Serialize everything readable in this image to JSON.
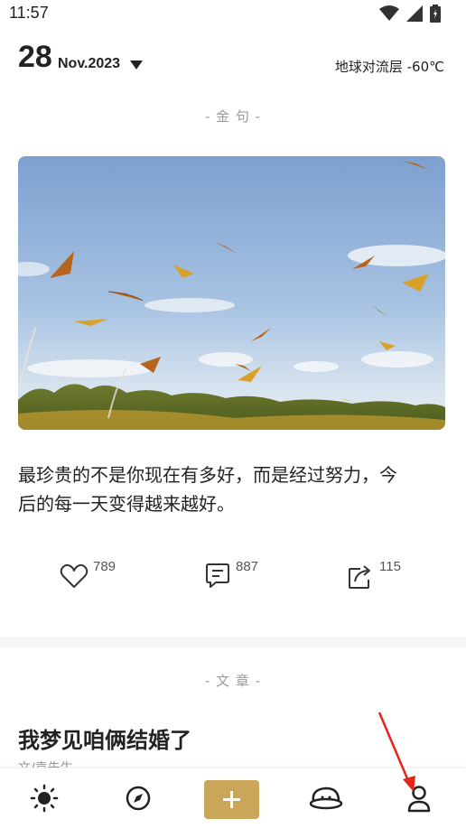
{
  "status_bar": {
    "time": "11:57"
  },
  "header": {
    "day": "28",
    "month_year": "Nov.2023",
    "weather": "地球对流层 -60℃"
  },
  "quote_section": {
    "label": "- 金 句 -",
    "text_line1": "最珍贵的不是你现在有多好，而是经过努力，今",
    "text_line2": "后的每一天变得越来越好。",
    "likes": "789",
    "comments": "887",
    "shares": "115"
  },
  "article_section": {
    "label": "- 文 章 -",
    "title": "我梦见咱俩结婚了",
    "author": "文/袁先生"
  },
  "bottom_nav": {
    "items": [
      "sun-icon",
      "compass-icon",
      "add-icon",
      "planet-icon",
      "profile-icon"
    ],
    "accent_color": "#c9a65a"
  },
  "annotation": {
    "arrow_color": "#e8231c"
  }
}
